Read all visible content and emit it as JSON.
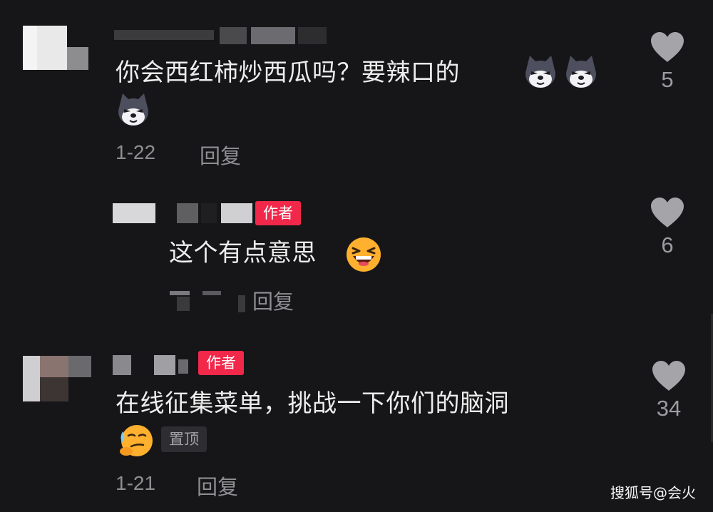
{
  "comments": [
    {
      "text": "你会西红柿炒西瓜吗？要辣口的",
      "date": "1-22",
      "reply_label": "回复",
      "likes": "5",
      "emojis": [
        "husky-emoji",
        "husky-emoji",
        "husky-emoji"
      ]
    },
    {
      "badge": "作者",
      "text": "这个有点意思",
      "reply_label": "回复",
      "likes": "6",
      "emojis": [
        "laughing-emoji"
      ]
    },
    {
      "badge": "作者",
      "text": "在线征集菜单，挑战一下你们的脑洞",
      "pin_label": "置顶",
      "date": "1-21",
      "reply_label": "回复",
      "likes": "34",
      "emojis": [
        "sweat-smirk-emoji"
      ]
    }
  ],
  "watermark": "搜狐号@会火",
  "colors": {
    "background": "#161618",
    "author_badge": "#f1284a",
    "muted_text": "#8f8f93",
    "heart": "#a5a5a9"
  },
  "icons": {
    "like": "heart-icon"
  }
}
